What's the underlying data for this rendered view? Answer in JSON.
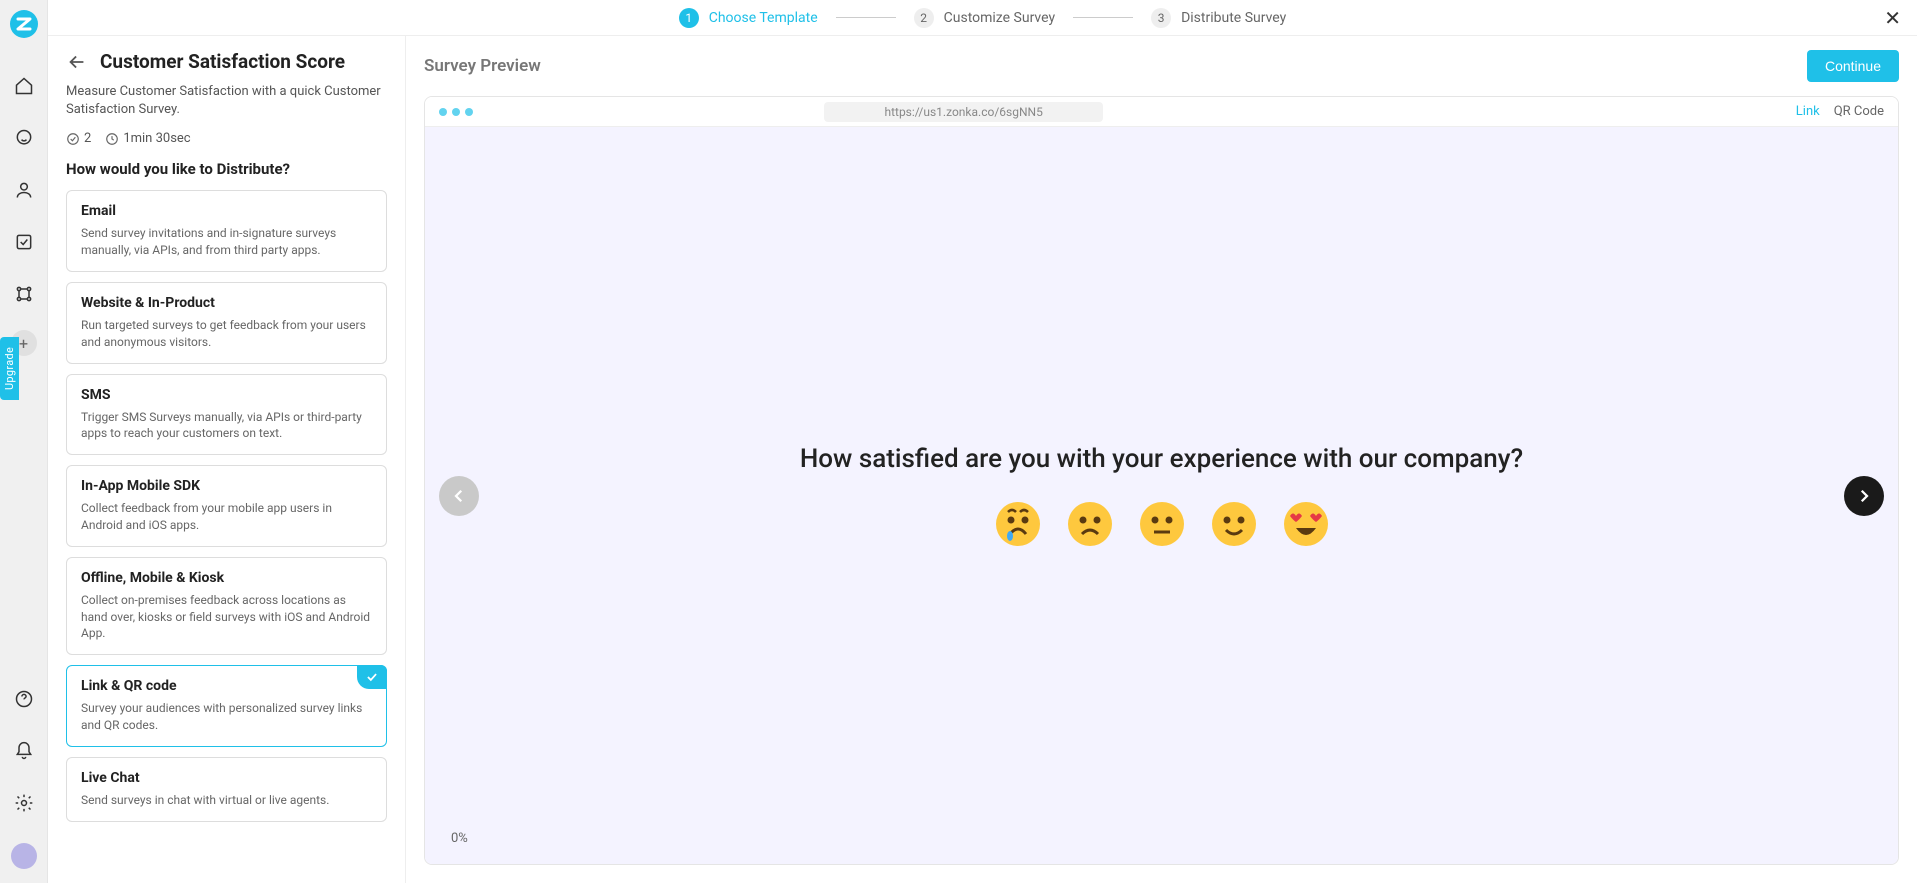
{
  "rail": {
    "upgrade_label": "Upgrade"
  },
  "stepper": {
    "steps": [
      {
        "num": "1",
        "label": "Choose Template"
      },
      {
        "num": "2",
        "label": "Customize Survey"
      },
      {
        "num": "3",
        "label": "Distribute Survey"
      }
    ]
  },
  "left": {
    "title": "Customer Satisfaction Score",
    "description": "Measure Customer Satisfaction with a quick Customer Satisfaction Survey.",
    "question_count": "2",
    "duration": "1min 30sec",
    "distribute_heading": "How would you like to Distribute?",
    "options": [
      {
        "title": "Email",
        "desc": "Send survey invitations and in-signature surveys manually, via APIs, and from third party apps."
      },
      {
        "title": "Website & In-Product",
        "desc": "Run targeted surveys to get feedback from your users and anonymous visitors."
      },
      {
        "title": "SMS",
        "desc": "Trigger SMS Surveys manually, via APIs or third-party apps to reach your customers on text."
      },
      {
        "title": "In-App Mobile SDK",
        "desc": "Collect feedback from your mobile app users in Android and iOS apps."
      },
      {
        "title": "Offline, Mobile & Kiosk",
        "desc": "Collect on-premises feedback across locations as hand over, kiosks or field surveys with iOS and Android App."
      },
      {
        "title": "Link & QR code",
        "desc": "Survey your audiences with personalized survey links and QR codes."
      },
      {
        "title": "Live Chat",
        "desc": "Send surveys in chat with virtual or live agents."
      }
    ],
    "selected_index": 5
  },
  "right": {
    "preview_label": "Survey Preview",
    "continue_label": "Continue",
    "url": "https://us1.zonka.co/6sgNN5",
    "tab_link": "Link",
    "tab_qr": "QR Code",
    "question": "How satisfied are you with your experience with our company?",
    "progress": "0%",
    "emojis": [
      "crying",
      "sad",
      "neutral",
      "happy",
      "love"
    ]
  }
}
